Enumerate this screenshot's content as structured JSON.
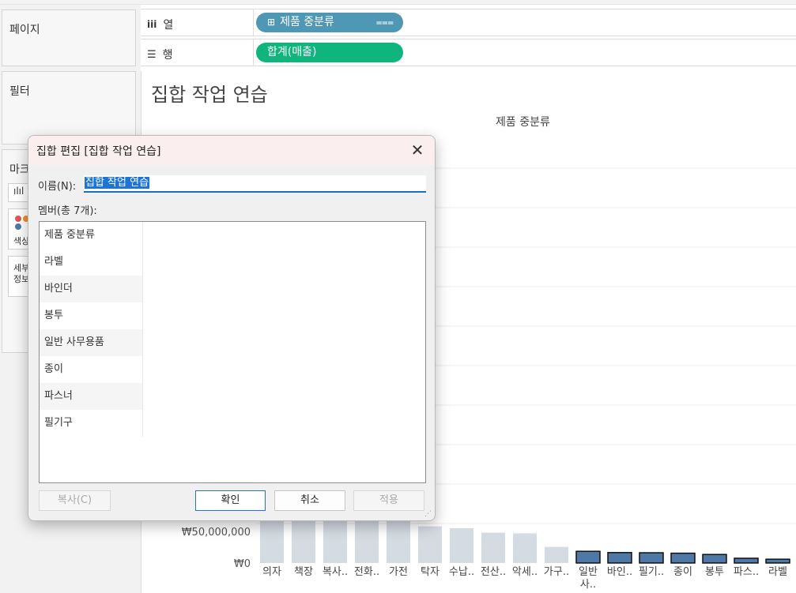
{
  "left_pane": {
    "pages_title": "페이지",
    "filters_title": "필터",
    "marks_title": "마크",
    "marks_color_label": "색상",
    "marks_detail_label": "세부\n정보"
  },
  "shelves": {
    "columns_label": "열",
    "columns_icon": "iii",
    "columns_pill": "제품 중분류",
    "columns_pill_color": "#4e98b5",
    "rows_label": "행",
    "rows_icon": "☰",
    "rows_pill": "합계(매출)",
    "rows_pill_color": "#0fb57c"
  },
  "sheet": {
    "title": "집합 작업 연습",
    "column_header": "제품 중분류"
  },
  "chart_data": {
    "type": "bar",
    "title": "집합 작업 연습",
    "xlabel": "제품 중분류",
    "categories": [
      "의자",
      "책장",
      "복사..",
      "전화..",
      "가전",
      "탁자",
      "수납..",
      "전산..",
      "악세..",
      "가구..",
      "일반 사..",
      "바인..",
      "필기..",
      "종이",
      "봉투",
      "파스..",
      "라벨"
    ],
    "values": [
      null,
      null,
      null,
      null,
      null,
      58000000,
      55000000,
      48000000,
      47000000,
      25500000,
      18500000,
      16500000,
      16200000,
      15500000,
      13500000,
      7500000,
      6000000
    ],
    "in_set": [
      false,
      false,
      false,
      false,
      false,
      false,
      false,
      false,
      false,
      false,
      true,
      true,
      true,
      true,
      true,
      true,
      true
    ],
    "y_tick_labels": [
      "₩0",
      "₩50,000,000"
    ],
    "y_ticks": [
      0,
      50000000
    ],
    "ylim": [
      0,
      125000000
    ],
    "colors": {
      "in_set": "#4e79a7",
      "out_set": "#d4dbe2"
    }
  },
  "dialog": {
    "title": "집합 편집 [집합 작업 연습]",
    "close_icon": "✕",
    "name_label": "이름(N):",
    "name_value": "집합 작업 연습",
    "members_label": "멤버(총 7개):",
    "members": [
      "제품 중분류",
      "라벨",
      "바인더",
      "봉투",
      "일반 사무용품",
      "종이",
      "파스너",
      "필기구"
    ],
    "copy_button": "복사(C)",
    "ok_button": "확인",
    "cancel_button": "취소",
    "apply_button": "적용"
  }
}
